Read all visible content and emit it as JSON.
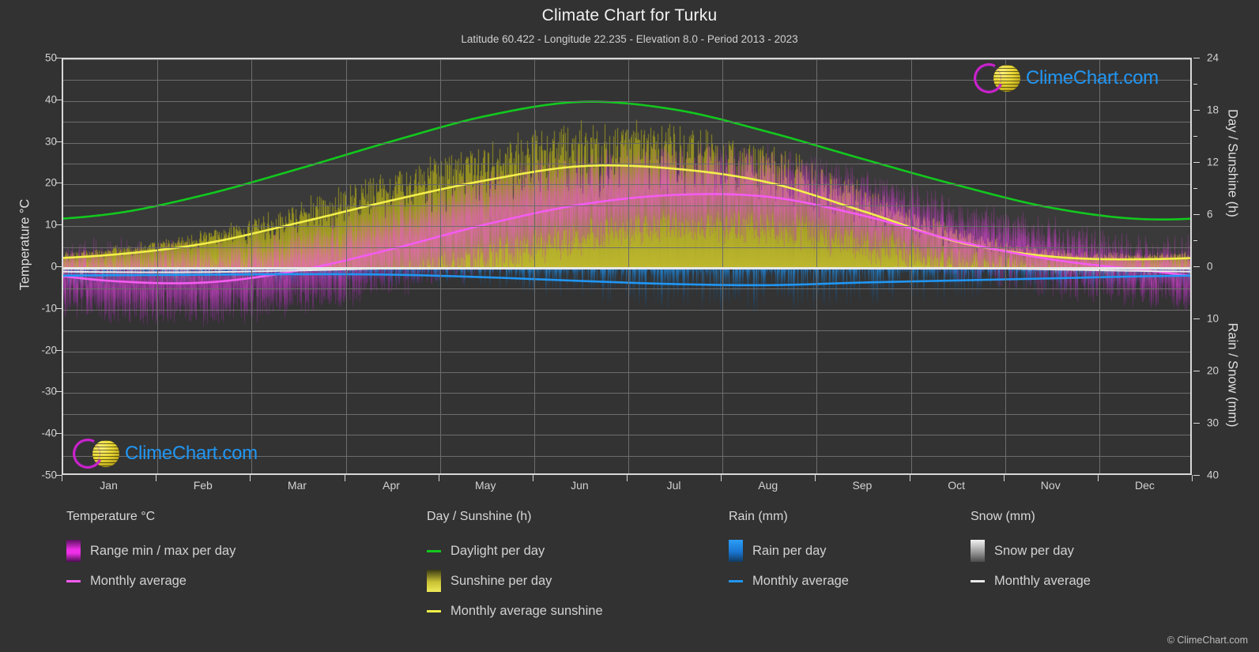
{
  "header": {
    "title": "Climate Chart for Turku",
    "subtitle": "Latitude 60.422 - Longitude 22.235 - Elevation 8.0 - Period 2013 - 2023"
  },
  "axes": {
    "left_label": "Temperature °C",
    "right_label_top": "Day / Sunshine (h)",
    "right_label_bottom": "Rain / Snow (mm)",
    "left_ticks": [
      "50",
      "40",
      "30",
      "20",
      "10",
      "0",
      "-10",
      "-20",
      "-30",
      "-40",
      "-50"
    ],
    "right_ticks_top": [
      "24",
      "18",
      "12",
      "6",
      "0"
    ],
    "right_ticks_bottom": [
      "10",
      "20",
      "30",
      "40"
    ],
    "x_ticks": [
      "Jan",
      "Feb",
      "Mar",
      "Apr",
      "May",
      "Jun",
      "Jul",
      "Aug",
      "Sep",
      "Oct",
      "Nov",
      "Dec"
    ]
  },
  "branding": {
    "logo_text": "ClimeChart.com",
    "copyright": "© ClimeChart.com"
  },
  "legend": {
    "columns": [
      {
        "title": "Temperature °C",
        "items": [
          {
            "label": "Range min / max per day",
            "marker": "gradient-magenta"
          },
          {
            "label": "Monthly average",
            "marker": "line-magenta"
          }
        ]
      },
      {
        "title": "Day / Sunshine (h)",
        "items": [
          {
            "label": "Daylight per day",
            "marker": "line-green"
          },
          {
            "label": "Sunshine per day",
            "marker": "gradient-yellow"
          },
          {
            "label": "Monthly average sunshine",
            "marker": "line-yellow"
          }
        ]
      },
      {
        "title": "Rain (mm)",
        "items": [
          {
            "label": "Rain per day",
            "marker": "gradient-blue"
          },
          {
            "label": "Monthly average",
            "marker": "line-blue"
          }
        ]
      },
      {
        "title": "Snow (mm)",
        "items": [
          {
            "label": "Snow per day",
            "marker": "gradient-grey"
          },
          {
            "label": "Monthly average",
            "marker": "line-white"
          }
        ]
      }
    ]
  },
  "colors": {
    "background": "#323232",
    "plot_background": "#333333",
    "grid": "#6d6d6d",
    "axis": "#d8d8d8",
    "text": "#d2d2d2",
    "daylight_green": "#12c81e",
    "sunshine_yellow": "#f2ef4a",
    "temperature_magenta": "#f45cf0",
    "rain_blue": "#2196f3",
    "snow_white": "#e8e8e8",
    "brand_blue": "#2196f3",
    "brand_magenta": "#cc22cc",
    "brand_yellow": "#e8d633"
  },
  "chart_data": {
    "type": "line",
    "title": "Climate Chart for Turku",
    "subtitle": "Latitude 60.422 - Longitude 22.235 - Elevation 8.0 - Period 2013 - 2023",
    "xlabel": "",
    "ylabel": "Temperature °C",
    "categories": [
      "Jan",
      "Feb",
      "Mar",
      "Apr",
      "May",
      "Jun",
      "Jul",
      "Aug",
      "Sep",
      "Oct",
      "Nov",
      "Dec"
    ],
    "ylim": [
      -50,
      50
    ],
    "y2lim_top": [
      0,
      24
    ],
    "y2lim_bottom": [
      0,
      40
    ],
    "grid": true,
    "legend_position": "below",
    "series": [
      {
        "name": "Daylight per day",
        "unit": "h",
        "axis": "right-top",
        "color": "#12c81e",
        "values": [
          6.2,
          8.4,
          11.4,
          14.6,
          17.5,
          19.1,
          18.2,
          15.6,
          12.5,
          9.5,
          6.9,
          5.6
        ]
      },
      {
        "name": "Monthly average sunshine",
        "unit": "h",
        "axis": "right-top",
        "color": "#f2ef4a",
        "values": [
          1.5,
          2.8,
          5.2,
          7.8,
          10.1,
          11.7,
          11.4,
          9.8,
          6.5,
          3.0,
          1.3,
          1.0
        ]
      },
      {
        "name": "Monthly average temperature",
        "unit": "°C",
        "axis": "left",
        "color": "#f45cf0",
        "values": [
          -3.1,
          -3.5,
          -0.6,
          4.6,
          10.5,
          15.2,
          17.5,
          17.0,
          12.5,
          6.4,
          2.0,
          -0.6
        ]
      },
      {
        "name": "Monthly average rain",
        "unit": "mm",
        "axis": "right-bottom",
        "color": "#2196f3",
        "values": [
          1.4,
          1.3,
          1.2,
          1.3,
          1.8,
          2.5,
          3.1,
          3.3,
          2.8,
          2.4,
          2.0,
          1.6
        ]
      },
      {
        "name": "Monthly average snow",
        "unit": "mm",
        "axis": "right-bottom",
        "color": "#e8e8e8",
        "values": [
          0.8,
          0.8,
          0.5,
          0.1,
          0.0,
          0.0,
          0.0,
          0.0,
          0.0,
          0.0,
          0.3,
          0.6
        ]
      },
      {
        "name": "Temperature range max per day",
        "unit": "°C",
        "axis": "left",
        "color": "#f45cf0",
        "values": [
          1.0,
          0.5,
          4.0,
          10.0,
          17.0,
          22.0,
          23.5,
          23.0,
          17.5,
          10.5,
          5.5,
          2.0
        ]
      },
      {
        "name": "Temperature range min per day",
        "unit": "°C",
        "axis": "left",
        "color": "#f45cf0",
        "values": [
          -7.0,
          -7.5,
          -5.0,
          -0.5,
          4.5,
          9.5,
          12.0,
          11.5,
          8.0,
          3.0,
          -1.0,
          -3.5
        ]
      }
    ]
  }
}
